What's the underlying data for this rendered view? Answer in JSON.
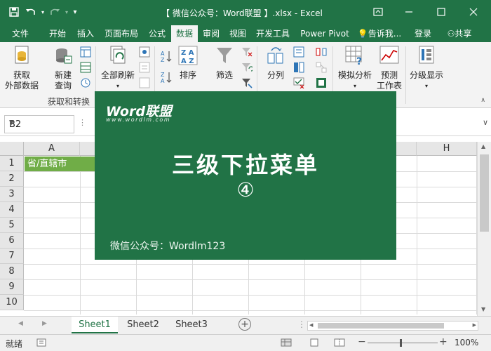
{
  "titlebar": {
    "doc_title": "【 微信公众号：Word联盟 】.xlsx - Excel"
  },
  "tabs": [
    "文件",
    "开始",
    "插入",
    "页面布局",
    "公式",
    "数据",
    "审阅",
    "视图",
    "开发工具",
    "Power Pivot"
  ],
  "tell_me": "告诉我...",
  "login": "登录",
  "share": "共享",
  "ribbon": {
    "get_external_data": "获取\n外部数据",
    "new_query": "新建\n查询",
    "refresh_all": "全部刷新",
    "sort": "排序",
    "filter": "筛选",
    "text_to_columns": "分列",
    "what_if": "模拟分析",
    "forecast_sheet": "预测\n工作表",
    "outline": "分级显示",
    "group_label": "获取和转换"
  },
  "formula_bar": {
    "name_box": "B2"
  },
  "grid": {
    "columns": [
      "A",
      "H"
    ],
    "rows": [
      "1",
      "2",
      "3",
      "4",
      "5",
      "6",
      "7",
      "8",
      "9",
      "10"
    ],
    "cell_A1": "省/直辖市"
  },
  "sheets": [
    "Sheet1",
    "Sheet2",
    "Sheet3"
  ],
  "status": {
    "ready": "就绪",
    "zoom": "100%"
  },
  "overlay": {
    "logo": "Word联盟",
    "logo_url": "www.wordlm.com",
    "title": "三级下拉菜单",
    "number": "④",
    "footer": "微信公众号：Wordlm123"
  },
  "colors": {
    "excel_green": "#217346",
    "cell_fill": "#70ad47"
  }
}
